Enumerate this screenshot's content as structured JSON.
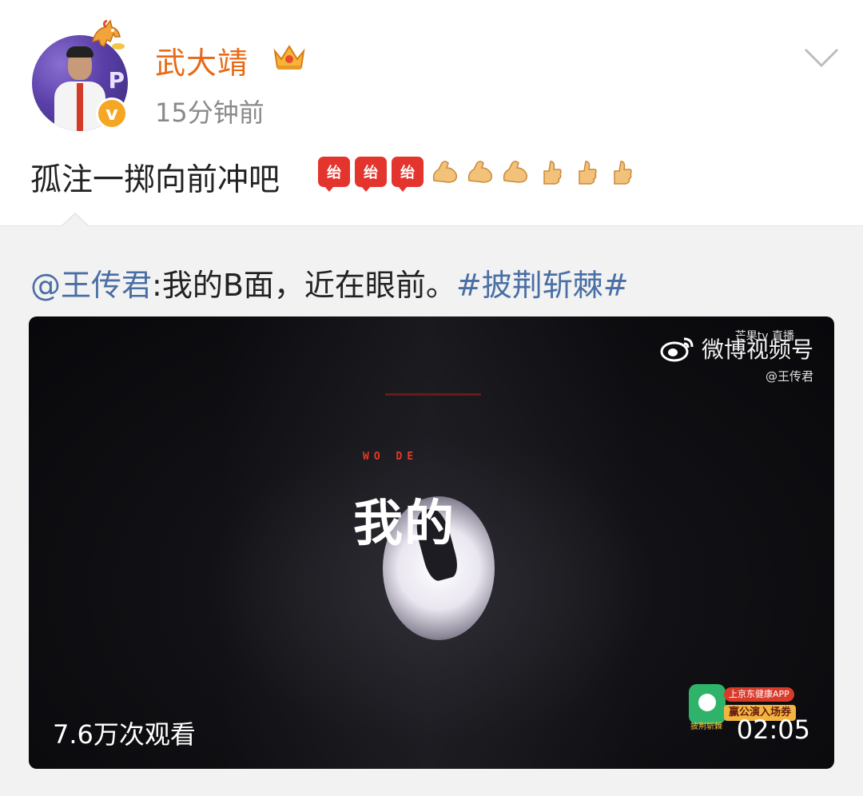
{
  "post": {
    "username": "武大靖",
    "timestamp": "15分钟前",
    "text": "孤注一掷向前冲吧",
    "emojis": [
      {
        "icon": "jiayou-emoji",
        "label": "绐"
      },
      {
        "icon": "jiayou-emoji",
        "label": "绐"
      },
      {
        "icon": "jiayou-emoji",
        "label": "绐"
      },
      {
        "icon": "flexed-biceps-emoji",
        "glyph": "💪"
      },
      {
        "icon": "flexed-biceps-emoji",
        "glyph": "💪"
      },
      {
        "icon": "flexed-biceps-emoji",
        "glyph": "💪"
      },
      {
        "icon": "thumbs-up-emoji",
        "glyph": "👍"
      },
      {
        "icon": "thumbs-up-emoji",
        "glyph": "👍"
      },
      {
        "icon": "thumbs-up-emoji",
        "glyph": "👍"
      }
    ],
    "avatar_letter": "P",
    "verified_mark": "v",
    "colors": {
      "username": "#e86a17",
      "link": "#4a6fa5",
      "verified": "#f5a623"
    }
  },
  "repost": {
    "mention": "@王传君",
    "text": ":我的B面，近在眼前。",
    "hashtag": "#披荆斩棘#"
  },
  "video": {
    "title_small": "WO DE",
    "title_big": "我的",
    "watermark_top": "芒果tv 直播",
    "watermark": "微博视频号",
    "watermark_sub": "@王传君",
    "views": "7.6万次观看",
    "duration": "02:05",
    "ad": {
      "line1": "上京东健康APP",
      "line2": "赢公演入场券",
      "line3": "披荆斩棘"
    }
  }
}
